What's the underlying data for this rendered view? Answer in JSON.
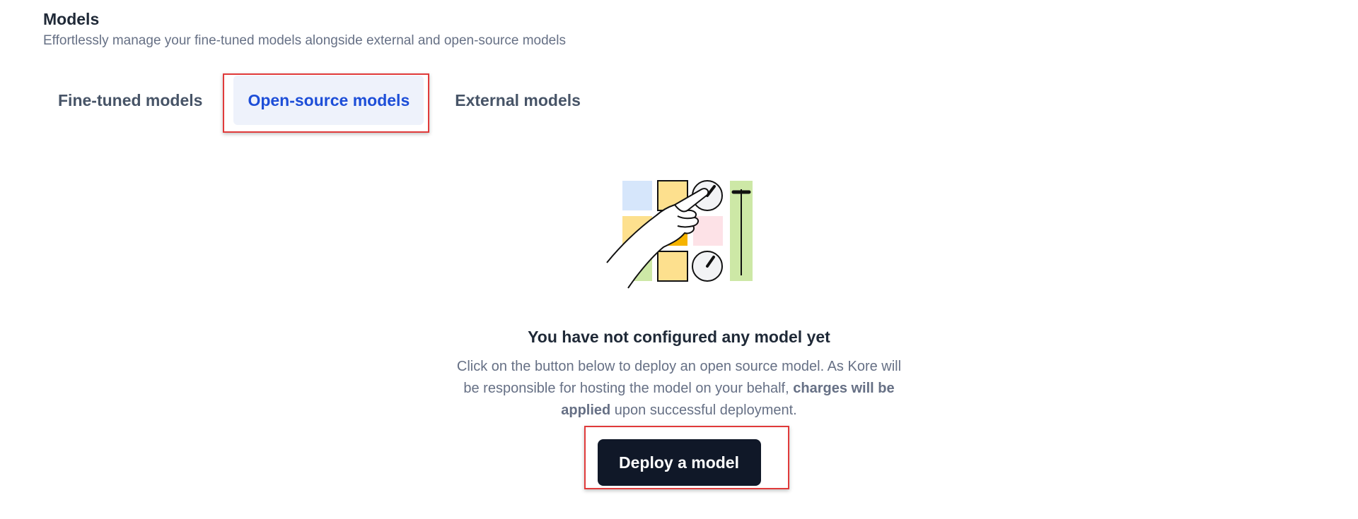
{
  "header": {
    "title": "Models",
    "subtitle": "Effortlessly manage your fine-tuned models alongside external and open-source models"
  },
  "tabs": [
    {
      "label": "Fine-tuned models",
      "active": false
    },
    {
      "label": "Open-source models",
      "active": true
    },
    {
      "label": "External models",
      "active": false
    }
  ],
  "empty_state": {
    "illustration": "control-panel-hand-illustration",
    "title": "You have not configured any model yet",
    "description_part1": "Click on the button below to deploy an open source model. As Kore will be responsible for hosting the model on your behalf, ",
    "description_bold": "charges will be applied",
    "description_part2": " upon successful deployment.",
    "button_label": "Deploy a model"
  },
  "colors": {
    "accent": "#1d4ed8",
    "active_tab_bg": "#eef2fb",
    "button_bg": "#101828",
    "highlight": "#e03a3a"
  }
}
